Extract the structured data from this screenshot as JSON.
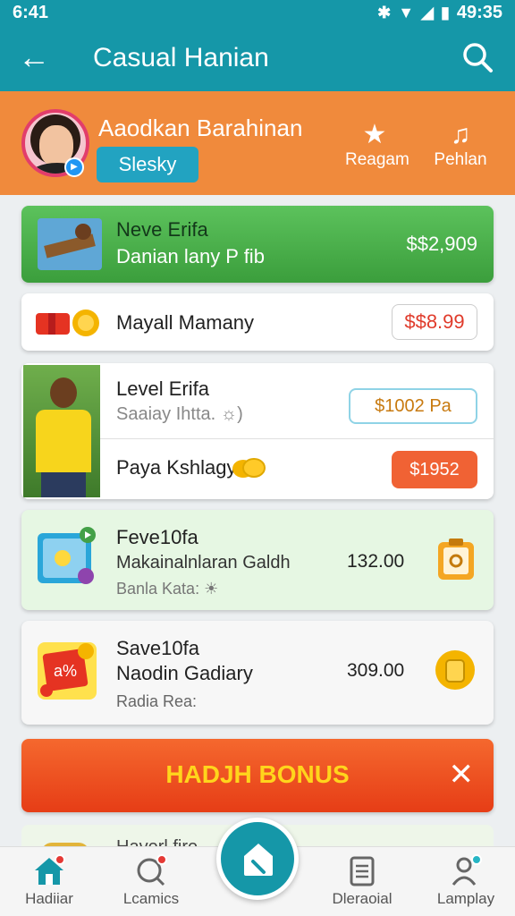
{
  "status_bar": {
    "time_left": "6:41",
    "time_right": "49:35"
  },
  "app_bar": {
    "title": "Casual Hanian"
  },
  "profile": {
    "name": "Aaodkan Barahinan",
    "pill_label": "Slesky",
    "actions": [
      {
        "label": "Reagam",
        "icon": "star-icon"
      },
      {
        "label": "Pehlan",
        "icon": "music-note-icon"
      }
    ]
  },
  "cards": {
    "green": {
      "title": "Neve Erifa",
      "subtitle": "Danian lany P fib",
      "price": "$$2,909"
    },
    "row1": {
      "label": "Mayall Mamany",
      "price": "$$8.99"
    },
    "row2": {
      "line1": "Level Erifa",
      "line2": "Saaiay Ihtta. ☼)",
      "button1": "$1002 Pa",
      "line3": "Paya Kshlagy",
      "button2": "$1952"
    },
    "fev": {
      "title": "Feve10fa",
      "subtitle": "Makainalnlaran Galdh",
      "note": "Banla Kata: ☀",
      "value": "132.00"
    },
    "save": {
      "title": "Save10fa",
      "subtitle": "Naodin Gadiary",
      "note": "Radia Rea:",
      "value": "309.00"
    }
  },
  "bonus": {
    "label": "HADJH BONUS"
  },
  "peek": {
    "text": "Haverl fire"
  },
  "bottom_nav": [
    {
      "label": "Hadiiar",
      "icon": "home-icon"
    },
    {
      "label": "Lcamics",
      "icon": "lessons-icon"
    },
    {
      "label": "Dleraoial",
      "icon": "list-icon"
    },
    {
      "label": "Lamplay",
      "icon": "leaderboard-icon"
    }
  ],
  "colors": {
    "primary": "#1597a8",
    "profile_bg": "#f08a3c",
    "bonus": "#e63d16",
    "bonus_text": "#ffd51c"
  }
}
